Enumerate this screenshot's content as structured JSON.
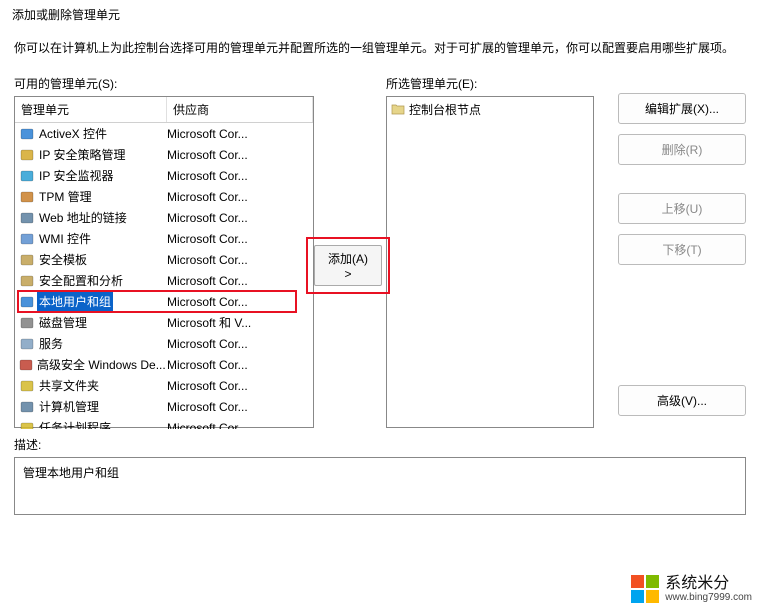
{
  "dialog": {
    "title": "添加或删除管理单元",
    "description": "你可以在计算机上为此控制台选择可用的管理单元并配置所选的一组管理单元。对于可扩展的管理单元，你可以配置要启用哪些扩展项。"
  },
  "available": {
    "label": "可用的管理单元(S):",
    "columns": {
      "name": "管理单元",
      "vendor": "供应商"
    },
    "items": [
      {
        "name": "ActiveX 控件",
        "vendor": "Microsoft Cor...",
        "icon": "activex"
      },
      {
        "name": "IP 安全策略管理",
        "vendor": "Microsoft Cor...",
        "icon": "ipsec-policy"
      },
      {
        "name": "IP 安全监视器",
        "vendor": "Microsoft Cor...",
        "icon": "ipsec-monitor"
      },
      {
        "name": "TPM 管理",
        "vendor": "Microsoft Cor...",
        "icon": "tpm"
      },
      {
        "name": "Web 地址的链接",
        "vendor": "Microsoft Cor...",
        "icon": "weblink"
      },
      {
        "name": "WMI 控件",
        "vendor": "Microsoft Cor...",
        "icon": "wmi"
      },
      {
        "name": "安全模板",
        "vendor": "Microsoft Cor...",
        "icon": "sec-template"
      },
      {
        "name": "安全配置和分析",
        "vendor": "Microsoft Cor...",
        "icon": "sec-config"
      },
      {
        "name": "本地用户和组",
        "vendor": "Microsoft Cor...",
        "icon": "users",
        "selected": true
      },
      {
        "name": "磁盘管理",
        "vendor": "Microsoft 和 V...",
        "icon": "disk"
      },
      {
        "name": "服务",
        "vendor": "Microsoft Cor...",
        "icon": "services"
      },
      {
        "name": "高级安全 Windows De...",
        "vendor": "Microsoft Cor...",
        "icon": "firewall"
      },
      {
        "name": "共享文件夹",
        "vendor": "Microsoft Cor...",
        "icon": "shared"
      },
      {
        "name": "计算机管理",
        "vendor": "Microsoft Cor...",
        "icon": "computer"
      },
      {
        "name": "任务计划程序",
        "vendor": "Microsoft Cor...",
        "icon": "tasks"
      }
    ]
  },
  "selected": {
    "label": "所选管理单元(E):",
    "root": "控制台根节点"
  },
  "buttons": {
    "add": "添加(A) >",
    "edit_ext": "编辑扩展(X)...",
    "remove": "删除(R)",
    "move_up": "上移(U)",
    "move_down": "下移(T)",
    "advanced": "高级(V)..."
  },
  "description_panel": {
    "label": "描述:",
    "text": "管理本地用户和组"
  },
  "watermark": {
    "text": "系统米分",
    "url": "www.bing7999.com"
  },
  "icon_colors": {
    "activex": "#2a7fd4",
    "ipsec-policy": "#d4a82a",
    "ipsec-monitor": "#2a9fd4",
    "tpm": "#c97f2a",
    "weblink": "#5a7f9f",
    "wmi": "#5a8fcf",
    "sec-template": "#bfa050",
    "sec-config": "#bfa050",
    "users": "#2a7fd4",
    "disk": "#7f7f7f",
    "services": "#7fa0c0",
    "firewall": "#c04030",
    "shared": "#d4b82a",
    "computer": "#5a7f9f",
    "tasks": "#d4b82a"
  }
}
